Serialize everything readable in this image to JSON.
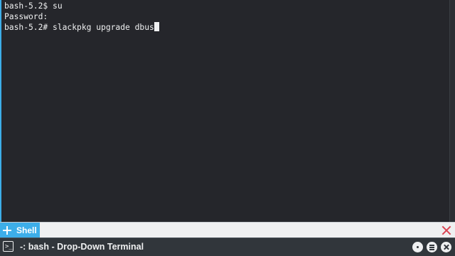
{
  "terminal": {
    "lines": [
      "bash-5.2$ su",
      "Password:",
      "bash-5.2# slackpkg upgrade dbus"
    ]
  },
  "tabbar": {
    "new_tab_icon": "plus-icon",
    "tabs": [
      {
        "label": "Shell",
        "active": true
      }
    ],
    "close_icon": "close-x-icon"
  },
  "titlebar": {
    "app_icon": "terminal-icon",
    "title": "-: bash - Drop-Down Terminal",
    "buttons": [
      "dot-icon",
      "hamburger-menu-icon",
      "close-icon"
    ]
  },
  "colors": {
    "background": "#25262b",
    "text": "#eff0f1",
    "accent": "#3daee9",
    "close_red": "#da4453",
    "titlebar": "#31363b"
  }
}
